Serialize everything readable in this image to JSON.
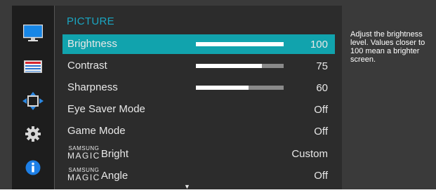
{
  "menu": {
    "title": "PICTURE",
    "items": [
      {
        "label": "Brightness",
        "value": "100",
        "bar": 1.0,
        "selected": true
      },
      {
        "label": "Contrast",
        "value": "75",
        "bar": 0.75
      },
      {
        "label": "Sharpness",
        "value": "60",
        "bar": 0.6
      },
      {
        "label": "Eye Saver Mode",
        "value": "Off"
      },
      {
        "label": "Game Mode",
        "value": "Off"
      },
      {
        "brand": "SAMSUNG",
        "brand_word": "MAGIC",
        "label": "Bright",
        "value": "Custom"
      },
      {
        "brand": "SAMSUNG",
        "brand_word": "MAGIC",
        "label": "Angle",
        "value": "Off"
      }
    ],
    "more_indicator": "▼"
  },
  "help": {
    "text": "Adjust the brightness level. Values closer to 100 mean a brighter screen."
  },
  "sidebar": {
    "icons": [
      "monitor-icon",
      "menu-list-icon",
      "position-arrows-icon",
      "gear-icon",
      "info-icon"
    ]
  },
  "colors": {
    "accent": "#11a3ad",
    "title": "#1aa6c2",
    "panel": "#2c2c2c",
    "sidebar": "#1d1d1d"
  }
}
